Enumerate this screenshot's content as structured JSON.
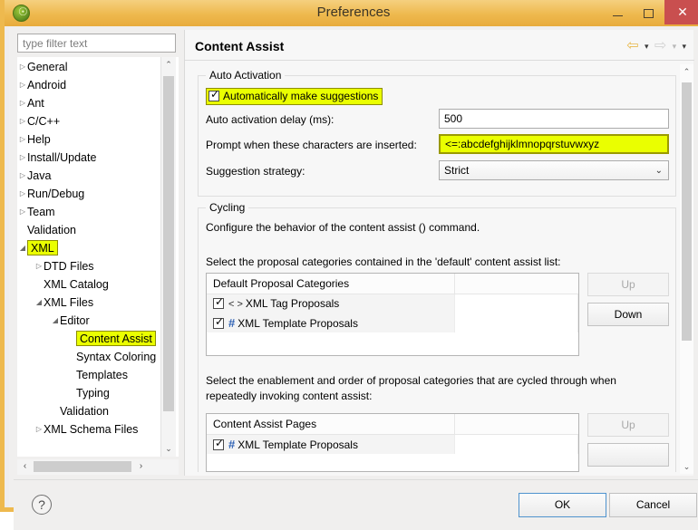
{
  "window": {
    "title": "Preferences",
    "app_icon": "eclipse-icon",
    "minimize_label": "Minimize",
    "maximize_label": "Maximize",
    "close_label": "✕"
  },
  "filter": {
    "placeholder": "type filter text",
    "value": ""
  },
  "tree": {
    "items": [
      {
        "label": "General",
        "indent": 10,
        "arrow": "▷",
        "expanded": false,
        "highlighted": false
      },
      {
        "label": "Android",
        "indent": 10,
        "arrow": "▷",
        "expanded": false,
        "highlighted": false
      },
      {
        "label": "Ant",
        "indent": 10,
        "arrow": "▷",
        "expanded": false,
        "highlighted": false
      },
      {
        "label": "C/C++",
        "indent": 10,
        "arrow": "▷",
        "expanded": false,
        "highlighted": false
      },
      {
        "label": "Help",
        "indent": 10,
        "arrow": "▷",
        "expanded": false,
        "highlighted": false
      },
      {
        "label": "Install/Update",
        "indent": 10,
        "arrow": "▷",
        "expanded": false,
        "highlighted": false
      },
      {
        "label": "Java",
        "indent": 10,
        "arrow": "▷",
        "expanded": false,
        "highlighted": false
      },
      {
        "label": "Run/Debug",
        "indent": 10,
        "arrow": "▷",
        "expanded": false,
        "highlighted": false
      },
      {
        "label": "Team",
        "indent": 10,
        "arrow": "▷",
        "expanded": false,
        "highlighted": false
      },
      {
        "label": "Validation",
        "indent": 10,
        "arrow": "",
        "expanded": false,
        "highlighted": false
      },
      {
        "label": "XML",
        "indent": 10,
        "arrow": "◢",
        "expanded": true,
        "highlighted": true
      },
      {
        "label": "DTD Files",
        "indent": 28,
        "arrow": "▷",
        "expanded": false,
        "highlighted": false
      },
      {
        "label": "XML Catalog",
        "indent": 28,
        "arrow": "",
        "expanded": false,
        "highlighted": false
      },
      {
        "label": "XML Files",
        "indent": 28,
        "arrow": "◢",
        "expanded": true,
        "highlighted": false
      },
      {
        "label": "Editor",
        "indent": 46,
        "arrow": "◢",
        "expanded": true,
        "highlighted": false
      },
      {
        "label": "Content Assist",
        "indent": 64,
        "arrow": "",
        "expanded": false,
        "highlighted": true
      },
      {
        "label": "Syntax Coloring",
        "indent": 64,
        "arrow": "",
        "expanded": false,
        "highlighted": false
      },
      {
        "label": "Templates",
        "indent": 64,
        "arrow": "",
        "expanded": false,
        "highlighted": false
      },
      {
        "label": "Typing",
        "indent": 64,
        "arrow": "",
        "expanded": false,
        "highlighted": false
      },
      {
        "label": "Validation",
        "indent": 46,
        "arrow": "",
        "expanded": false,
        "highlighted": false
      },
      {
        "label": "XML Schema Files",
        "indent": 28,
        "arrow": "▷",
        "expanded": false,
        "highlighted": false
      }
    ],
    "scroll_up": "⌃",
    "scroll_down": "⌄",
    "scroll_left": "‹",
    "scroll_right": "›"
  },
  "page": {
    "title": "Content Assist",
    "nav": {
      "back": "⇦",
      "back_menu": "▾",
      "forward": "⇨",
      "forward_menu": "▾",
      "view_menu": "▾"
    }
  },
  "auto_activation": {
    "group_title": "Auto Activation",
    "auto_suggest_label": "Automatically make suggestions",
    "auto_suggest_checked": true,
    "delay_label": "Auto activation delay (ms):",
    "delay_value": "500",
    "prompt_label": "Prompt when these characters are inserted:",
    "prompt_value": "<=:abcdefghijklmnopqrstuvwxyz",
    "strategy_label": "Suggestion strategy:",
    "strategy_value": "Strict",
    "strategy_chevron": "⌄"
  },
  "cycling": {
    "group_title": "Cycling",
    "description": "Configure the behavior of the content assist () command.",
    "default_list_label": "Select the proposal categories contained in the 'default' content assist list:",
    "default_list": {
      "header": [
        "Default Proposal Categories",
        ""
      ],
      "rows": [
        {
          "checked": true,
          "icon": "xml-tag-icon",
          "icon_glyph": "< >",
          "label": "XML Tag Proposals"
        },
        {
          "checked": true,
          "icon": "template-icon",
          "icon_glyph": "#",
          "label": "XML Template Proposals"
        }
      ],
      "up_label": "Up",
      "up_enabled": false,
      "down_label": "Down",
      "down_enabled": true
    },
    "cycle_list_label": "Select the enablement and order of proposal categories that are cycled through when repeatedly invoking content assist:",
    "cycle_list": {
      "header": [
        "Content Assist Pages",
        ""
      ],
      "rows": [
        {
          "checked": true,
          "icon": "template-icon",
          "icon_glyph": "#",
          "label": "XML Template Proposals"
        }
      ],
      "up_label": "Up",
      "up_enabled": false
    }
  },
  "content_scroll": {
    "up": "⌃",
    "down": "⌄"
  },
  "footer": {
    "help_icon": "?",
    "ok_label": "OK",
    "cancel_label": "Cancel"
  }
}
